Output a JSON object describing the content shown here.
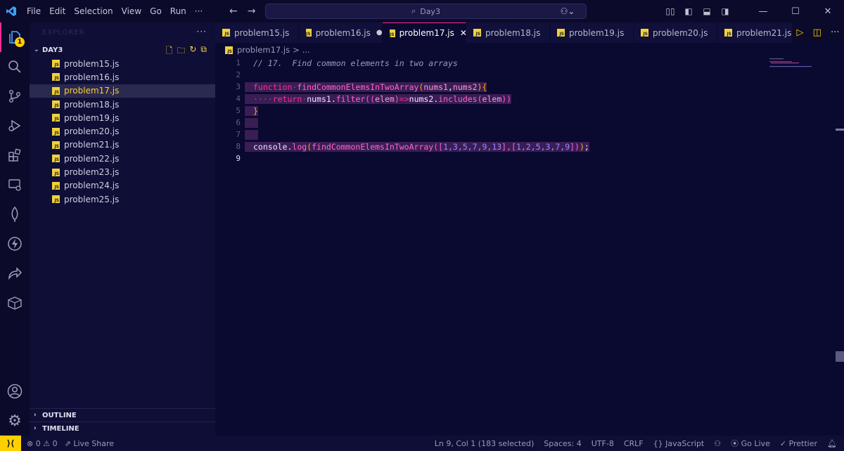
{
  "titlebar": {
    "menu": [
      "File",
      "Edit",
      "Selection",
      "View",
      "Go",
      "Run",
      "···"
    ],
    "search": "Day3",
    "window_controls": [
      "minimize-icon",
      "maximize-icon",
      "close-icon"
    ]
  },
  "activity": {
    "badge": "1",
    "icons": [
      "explorer-icon",
      "search-icon",
      "source-control-icon",
      "run-debug-icon",
      "extensions-icon",
      "remote-explorer-icon",
      "mongodb-icon",
      "thunder-client-icon",
      "live-share-icon",
      "packages-icon",
      "account-icon",
      "settings-icon"
    ]
  },
  "sidebar": {
    "header": "EXPLORER",
    "more": "···",
    "folder": "DAY3",
    "files": [
      "problem15.js",
      "problem16.js",
      "problem17.js",
      "problem18.js",
      "problem19.js",
      "problem20.js",
      "problem21.js",
      "problem22.js",
      "problem23.js",
      "problem24.js",
      "problem25.js"
    ],
    "active_file": "problem17.js",
    "outline": "OUTLINE",
    "timeline": "TIMELINE"
  },
  "tabs": [
    {
      "label": "problem15.js"
    },
    {
      "label": "problem16.js",
      "modified": "●"
    },
    {
      "label": "problem17.js",
      "close": "✕"
    },
    {
      "label": "problem18.js"
    },
    {
      "label": "problem19.js"
    },
    {
      "label": "problem20.js"
    },
    {
      "label": "problem21.js"
    }
  ],
  "breadcrumb": {
    "file": "problem17.js",
    "sep": ">",
    "rest": "..."
  },
  "editor": {
    "line_numbers": [
      "1",
      "2",
      "3",
      "4",
      "5",
      "6",
      "7",
      "8",
      "9"
    ],
    "line1": "// 17.  Find common elements in two arrays",
    "l3_kw": "function",
    "l3_fn": "findCommonElemsInTwoArray",
    "l3_p1": "nums1",
    "l3_p2": "nums2",
    "l4_kw": "return",
    "l4_a": "nums1",
    "l4_m": "filter",
    "l4_p": "elem",
    "l4_arrow": "=>",
    "l4_b": "nums2",
    "l4_m2": "includes",
    "l4_p2": "elem",
    "l8_obj": "console",
    "l8_m": "log",
    "l8_fn": "findCommonElemsInTwoArray",
    "l8_a1": "1,3,5,7,9,13",
    "l8_a2": "1,2,5,3,7,9"
  },
  "status": {
    "errors": "0",
    "warnings": "0",
    "live_share": "Live Share",
    "position": "Ln 9, Col 1 (183 selected)",
    "spaces": "Spaces: 4",
    "encoding": "UTF-8",
    "eol": "CRLF",
    "language": "JavaScript",
    "go_live": "Go Live",
    "prettier": "Prettier"
  },
  "colors": {
    "accent": "#ff2d95",
    "badge": "#ffd000",
    "background": "#0a0930"
  }
}
